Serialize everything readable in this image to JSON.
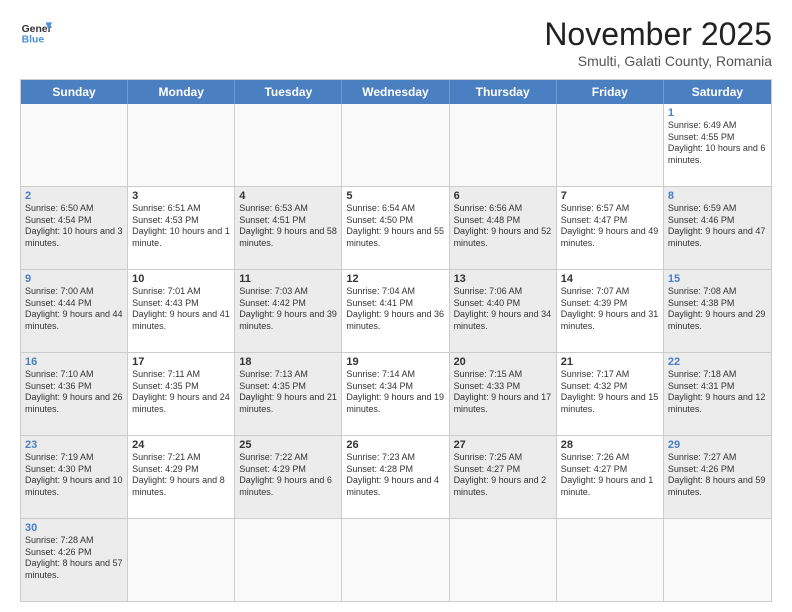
{
  "logo": {
    "text_general": "General",
    "text_blue": "Blue"
  },
  "title": "November 2025",
  "subtitle": "Smulti, Galati County, Romania",
  "weekdays": [
    "Sunday",
    "Monday",
    "Tuesday",
    "Wednesday",
    "Thursday",
    "Friday",
    "Saturday"
  ],
  "weeks": [
    [
      {
        "day": "",
        "info": "",
        "empty": true
      },
      {
        "day": "",
        "info": "",
        "empty": true
      },
      {
        "day": "",
        "info": "",
        "empty": true
      },
      {
        "day": "",
        "info": "",
        "empty": true
      },
      {
        "day": "",
        "info": "",
        "empty": true
      },
      {
        "day": "",
        "info": "",
        "empty": true
      },
      {
        "day": "1",
        "info": "Sunrise: 6:49 AM\nSunset: 4:55 PM\nDaylight: 10 hours and 6 minutes."
      }
    ],
    [
      {
        "day": "2",
        "info": "Sunrise: 6:50 AM\nSunset: 4:54 PM\nDaylight: 10 hours and 3 minutes.",
        "shaded": true
      },
      {
        "day": "3",
        "info": "Sunrise: 6:51 AM\nSunset: 4:53 PM\nDaylight: 10 hours and 1 minute."
      },
      {
        "day": "4",
        "info": "Sunrise: 6:53 AM\nSunset: 4:51 PM\nDaylight: 9 hours and 58 minutes.",
        "shaded": true
      },
      {
        "day": "5",
        "info": "Sunrise: 6:54 AM\nSunset: 4:50 PM\nDaylight: 9 hours and 55 minutes."
      },
      {
        "day": "6",
        "info": "Sunrise: 6:56 AM\nSunset: 4:48 PM\nDaylight: 9 hours and 52 minutes.",
        "shaded": true
      },
      {
        "day": "7",
        "info": "Sunrise: 6:57 AM\nSunset: 4:47 PM\nDaylight: 9 hours and 49 minutes."
      },
      {
        "day": "8",
        "info": "Sunrise: 6:59 AM\nSunset: 4:46 PM\nDaylight: 9 hours and 47 minutes.",
        "shaded": true
      }
    ],
    [
      {
        "day": "9",
        "info": "Sunrise: 7:00 AM\nSunset: 4:44 PM\nDaylight: 9 hours and 44 minutes.",
        "shaded": true
      },
      {
        "day": "10",
        "info": "Sunrise: 7:01 AM\nSunset: 4:43 PM\nDaylight: 9 hours and 41 minutes."
      },
      {
        "day": "11",
        "info": "Sunrise: 7:03 AM\nSunset: 4:42 PM\nDaylight: 9 hours and 39 minutes.",
        "shaded": true
      },
      {
        "day": "12",
        "info": "Sunrise: 7:04 AM\nSunset: 4:41 PM\nDaylight: 9 hours and 36 minutes."
      },
      {
        "day": "13",
        "info": "Sunrise: 7:06 AM\nSunset: 4:40 PM\nDaylight: 9 hours and 34 minutes.",
        "shaded": true
      },
      {
        "day": "14",
        "info": "Sunrise: 7:07 AM\nSunset: 4:39 PM\nDaylight: 9 hours and 31 minutes."
      },
      {
        "day": "15",
        "info": "Sunrise: 7:08 AM\nSunset: 4:38 PM\nDaylight: 9 hours and 29 minutes.",
        "shaded": true
      }
    ],
    [
      {
        "day": "16",
        "info": "Sunrise: 7:10 AM\nSunset: 4:36 PM\nDaylight: 9 hours and 26 minutes.",
        "shaded": true
      },
      {
        "day": "17",
        "info": "Sunrise: 7:11 AM\nSunset: 4:35 PM\nDaylight: 9 hours and 24 minutes."
      },
      {
        "day": "18",
        "info": "Sunrise: 7:13 AM\nSunset: 4:35 PM\nDaylight: 9 hours and 21 minutes.",
        "shaded": true
      },
      {
        "day": "19",
        "info": "Sunrise: 7:14 AM\nSunset: 4:34 PM\nDaylight: 9 hours and 19 minutes."
      },
      {
        "day": "20",
        "info": "Sunrise: 7:15 AM\nSunset: 4:33 PM\nDaylight: 9 hours and 17 minutes.",
        "shaded": true
      },
      {
        "day": "21",
        "info": "Sunrise: 7:17 AM\nSunset: 4:32 PM\nDaylight: 9 hours and 15 minutes."
      },
      {
        "day": "22",
        "info": "Sunrise: 7:18 AM\nSunset: 4:31 PM\nDaylight: 9 hours and 12 minutes.",
        "shaded": true
      }
    ],
    [
      {
        "day": "23",
        "info": "Sunrise: 7:19 AM\nSunset: 4:30 PM\nDaylight: 9 hours and 10 minutes.",
        "shaded": true
      },
      {
        "day": "24",
        "info": "Sunrise: 7:21 AM\nSunset: 4:29 PM\nDaylight: 9 hours and 8 minutes."
      },
      {
        "day": "25",
        "info": "Sunrise: 7:22 AM\nSunset: 4:29 PM\nDaylight: 9 hours and 6 minutes.",
        "shaded": true
      },
      {
        "day": "26",
        "info": "Sunrise: 7:23 AM\nSunset: 4:28 PM\nDaylight: 9 hours and 4 minutes."
      },
      {
        "day": "27",
        "info": "Sunrise: 7:25 AM\nSunset: 4:27 PM\nDaylight: 9 hours and 2 minutes.",
        "shaded": true
      },
      {
        "day": "28",
        "info": "Sunrise: 7:26 AM\nSunset: 4:27 PM\nDaylight: 9 hours and 1 minute."
      },
      {
        "day": "29",
        "info": "Sunrise: 7:27 AM\nSunset: 4:26 PM\nDaylight: 8 hours and 59 minutes.",
        "shaded": true
      }
    ],
    [
      {
        "day": "30",
        "info": "Sunrise: 7:28 AM\nSunset: 4:26 PM\nDaylight: 8 hours and 57 minutes.",
        "shaded": true
      },
      {
        "day": "",
        "info": "",
        "empty": true
      },
      {
        "day": "",
        "info": "",
        "empty": true
      },
      {
        "day": "",
        "info": "",
        "empty": true
      },
      {
        "day": "",
        "info": "",
        "empty": true
      },
      {
        "day": "",
        "info": "",
        "empty": true
      },
      {
        "day": "",
        "info": "",
        "empty": true
      }
    ]
  ]
}
